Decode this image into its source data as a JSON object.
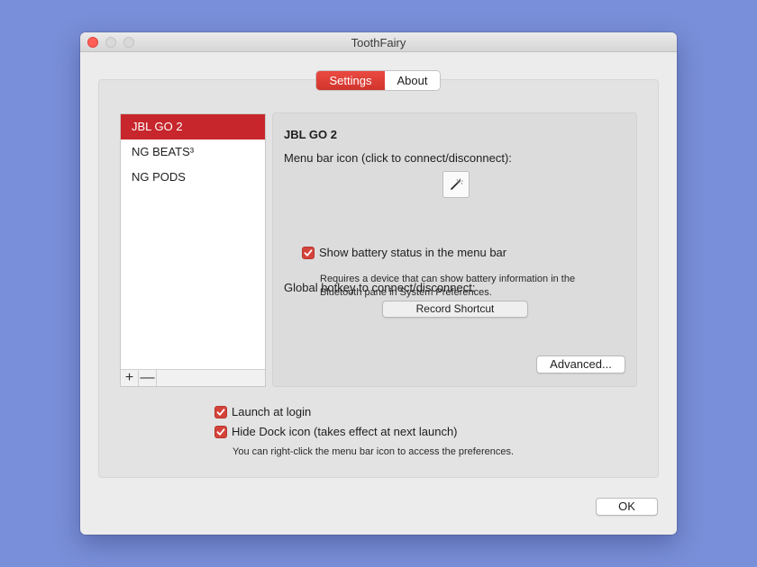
{
  "window": {
    "title": "ToothFairy"
  },
  "tabs": [
    {
      "label": "Settings",
      "active": true
    },
    {
      "label": "About",
      "active": false
    }
  ],
  "devices": [
    {
      "name": "JBL GO 2",
      "selected": true
    },
    {
      "name": "NG BEATS³",
      "selected": false
    },
    {
      "name": "NG PODS",
      "selected": false
    }
  ],
  "list_controls": {
    "add_label": "+",
    "remove_label": "—"
  },
  "detail": {
    "device_title": "JBL GO 2",
    "menu_bar_icon_label": "Menu bar icon (click to connect/disconnect):",
    "menu_bar_icon": "magic-wand-icon",
    "battery_checkbox": {
      "label": "Show battery status in the menu bar",
      "checked": true
    },
    "battery_note_line1": "Requires a device that can show battery information in the",
    "battery_note_line2": "Bluetooth pane in System Preferences.",
    "hotkey_label": "Global hotkey to connect/disconnect:",
    "record_shortcut_label": "Record Shortcut",
    "advanced_label": "Advanced..."
  },
  "general": {
    "launch_at_login": {
      "label": "Launch at login",
      "checked": true
    },
    "hide_dock_icon": {
      "label": "Hide Dock icon (takes effect at next launch)",
      "checked": true
    },
    "note": "You can right-click the menu bar icon to access the preferences."
  },
  "ok_label": "OK",
  "colors": {
    "accent": "#d4433a",
    "selection": "#c7262c",
    "desktop": "#7a8fd9"
  }
}
